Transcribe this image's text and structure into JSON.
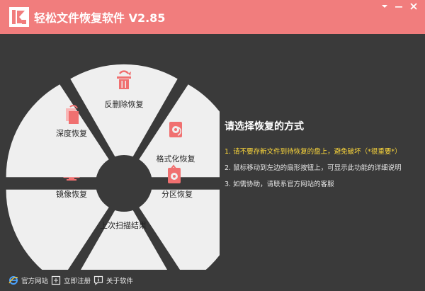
{
  "app": {
    "title": "轻松文件恢复软件 V2.85",
    "accent": "#f17d7d",
    "background": "#3a3a3a"
  },
  "wheel": {
    "segments": [
      {
        "id": "undelete",
        "label": "反删除恢复",
        "icon": "trash-restore-icon"
      },
      {
        "id": "format",
        "label": "格式化恢复",
        "icon": "drive-restore-icon"
      },
      {
        "id": "partition",
        "label": "分区恢复",
        "icon": "partition-restore-icon"
      },
      {
        "id": "last-scan",
        "label": "上次扫描结果",
        "icon": "computer-scan-icon"
      },
      {
        "id": "mirror",
        "label": "镜像恢复",
        "icon": "monitor-mirror-icon"
      },
      {
        "id": "deep",
        "label": "深度恢复",
        "icon": "documents-deep-icon"
      }
    ]
  },
  "panel": {
    "title": "请选择恢复的方式",
    "tips": [
      "1. 请不要存新文件到待恢复的盘上，避免破坏（*很重要*）",
      "2. 鼠标移动到左边的扇形按钮上，可显示此功能的详细说明",
      "3. 如需协助，请联系官方网站的客服"
    ]
  },
  "statusbar": {
    "items": [
      {
        "label": "官方网站",
        "icon": "ie-browser-icon"
      },
      {
        "label": "立即注册",
        "icon": "register-icon"
      },
      {
        "label": "关于软件",
        "icon": "about-info-icon"
      }
    ]
  }
}
